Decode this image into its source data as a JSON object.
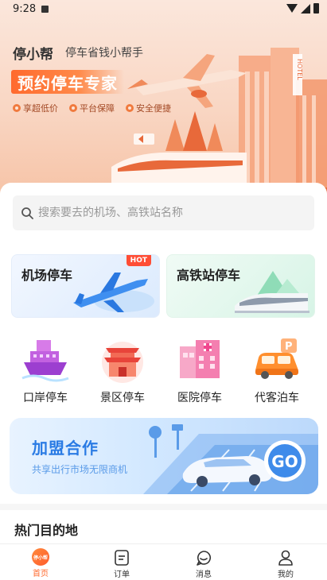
{
  "status_bar": {
    "time": "9:28"
  },
  "hero": {
    "brand": "停小帮",
    "slogan": "停车省钱小帮手",
    "headline": "预约停车专家",
    "features": [
      "享超低价",
      "平台保障",
      "安全便捷"
    ],
    "hotel_sign": "HOTEL"
  },
  "search": {
    "placeholder": "搜索要去的机场、高铁站名称",
    "value": ""
  },
  "cards": {
    "airport": {
      "title": "机场停车",
      "badge": "HOT"
    },
    "rail": {
      "title": "高铁站停车"
    }
  },
  "services": [
    {
      "label": "口岸停车",
      "icon": "ship-icon"
    },
    {
      "label": "景区停车",
      "icon": "gate-icon"
    },
    {
      "label": "医院停车",
      "icon": "hospital-icon"
    },
    {
      "label": "代客泊车",
      "icon": "valet-car-icon"
    }
  ],
  "join_banner": {
    "title": "加盟合作",
    "subtitle": "共享出行市场无限商机",
    "go_label": "GO"
  },
  "section": {
    "hot_destinations": "热门目的地"
  },
  "tabs": [
    {
      "label": "首页",
      "badge": "停小帮",
      "active": true
    },
    {
      "label": "订单"
    },
    {
      "label": "消息"
    },
    {
      "label": "我的"
    }
  ],
  "colors": {
    "accent": "#ff6a2e",
    "join_blue": "#2a7be4",
    "hot_red": "#ff4d35"
  }
}
